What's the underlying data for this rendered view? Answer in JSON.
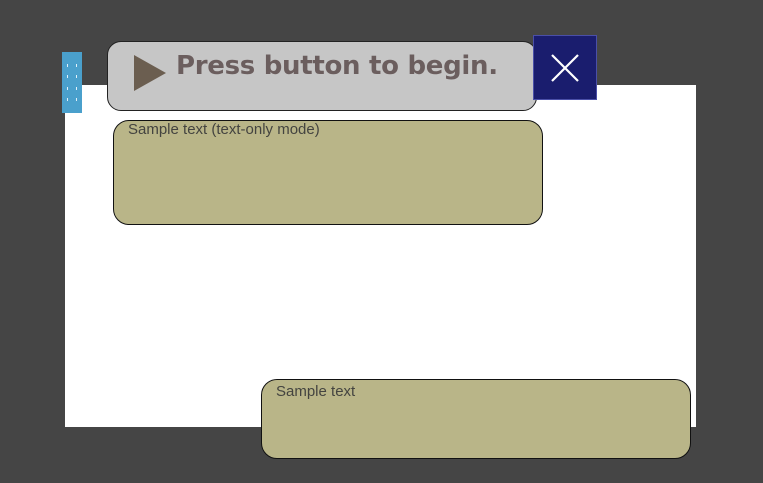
{
  "prompt": {
    "text": "Press button to begin.",
    "icon": "play-icon"
  },
  "close_button": {
    "icon": "close-icon"
  },
  "text_boxes": [
    {
      "label": "Sample text (text-only mode)"
    },
    {
      "label": "Sample text"
    }
  ],
  "colors": {
    "background": "#454545",
    "canvas": "#ffffff",
    "prompt_bar": "#c6c6c6",
    "prompt_text": "#6b5e5e",
    "close_button": "#1a1d6e",
    "text_box": "#b9b588",
    "side_tab": "#4aa0cc"
  }
}
